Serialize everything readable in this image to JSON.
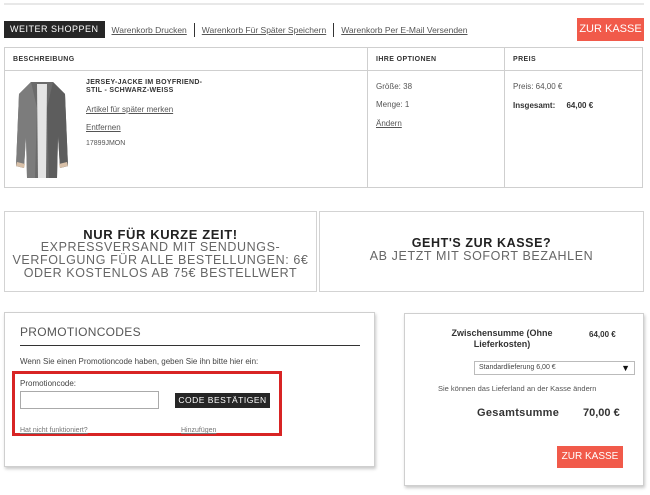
{
  "colors": {
    "accent_red": "#f15a4a",
    "dark_button": "#262626",
    "highlight_frame": "#d82424"
  },
  "toolbar": {
    "continue_shopping": "WEITER SHOPPEN",
    "links": [
      "Warenkorb Drucken",
      "Warenkorb Für Später Speichern",
      "Warenkorb Per E-Mail Versenden"
    ],
    "checkout": "ZUR KASSE"
  },
  "cart": {
    "headers": [
      "BESCHREIBUNG",
      "IHRE OPTIONEN",
      "PREIS"
    ],
    "item": {
      "name_line1": "JERSEY-JACKE IM BOYFRIEND-",
      "name_line2": "STIL - SCHWARZ-WEISS",
      "save_later": "Artikel für später merken",
      "remove": "Entfernen",
      "sku": "17899JMON",
      "size": "Größe: 38",
      "quantity": "Menge: 1",
      "change": "Ändern",
      "price": "Preis: 64,00 €",
      "total_label": "Insgesamt:",
      "total_value": "64,00 €"
    }
  },
  "banners": {
    "left": {
      "headline": "NUR FÜR KURZE ZEIT!",
      "lines": [
        "EXPRESSVERSAND MIT SENDUNGS-",
        "VERFOLGUNG FÜR ALLE BESTELLUNGEN: 6€",
        "ODER KOSTENLOS AB 75€ BESTELLWERT"
      ]
    },
    "right": {
      "headline": "GEHT'S ZUR KASSE?",
      "line": "AB JETZT MIT SOFORT BEZAHLEN"
    }
  },
  "promo": {
    "title": "PROMOTIONCODES",
    "hint": "Wenn Sie einen Promotioncode haben, geben Sie ihn bitte hier ein:",
    "label": "Promotioncode:",
    "input_value": "",
    "confirm": "CODE BESTÄTIGEN",
    "not_working": "Hat nicht funktioniert?",
    "add": "Hinzufügen"
  },
  "summary": {
    "subtotal_line1": "Zwischensumme (Ohne",
    "subtotal_line2": "Lieferkosten)",
    "subtotal_value": "64,00 €",
    "shipping_option": "Standardlieferung 6,00 €",
    "shipping_note": "Sie können das Lieferland an der Kasse ändern",
    "grand_total_label": "Gesamtsumme",
    "grand_total_value": "70,00 €",
    "checkout": "ZUR KASSE"
  }
}
